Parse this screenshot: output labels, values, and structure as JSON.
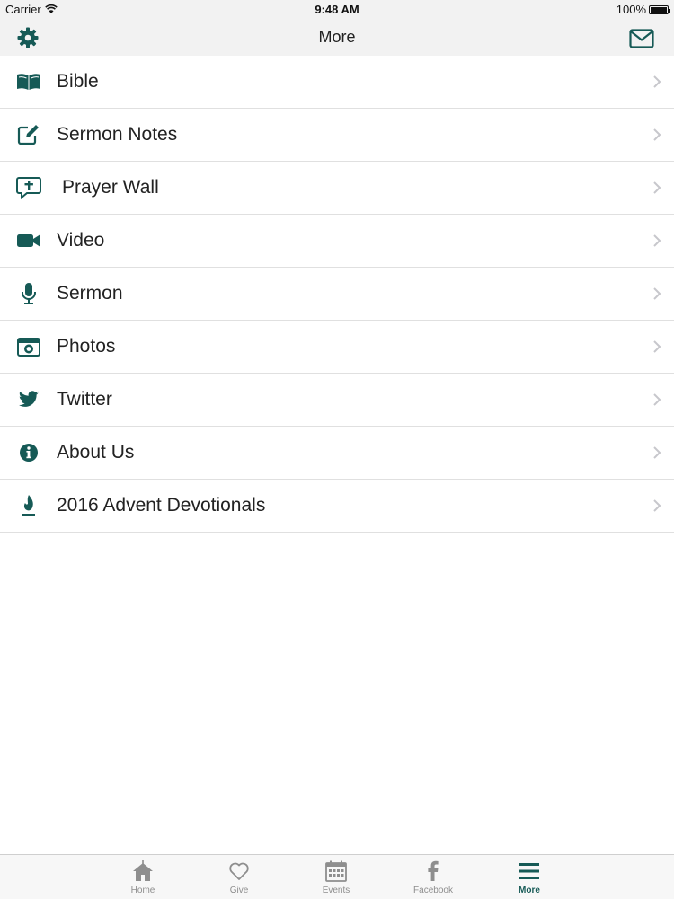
{
  "status_bar": {
    "carrier": "Carrier",
    "time": "9:48 AM",
    "battery": "100%"
  },
  "nav": {
    "title": "More",
    "left_icon": "gear-icon",
    "right_icon": "mail-icon"
  },
  "colors": {
    "accent": "#165a56",
    "chevron": "#c7c7cc",
    "tab_inactive": "#8e8e8e"
  },
  "menu": [
    {
      "label": "Bible",
      "icon": "book-icon"
    },
    {
      "label": "Sermon Notes",
      "icon": "edit-icon"
    },
    {
      "label": "Prayer Wall",
      "icon": "prayer-chat-icon"
    },
    {
      "label": "Video",
      "icon": "video-camera-icon"
    },
    {
      "label": "Sermon",
      "icon": "microphone-icon"
    },
    {
      "label": "Photos",
      "icon": "camera-icon"
    },
    {
      "label": "Twitter",
      "icon": "twitter-bird-icon"
    },
    {
      "label": "About Us",
      "icon": "info-icon"
    },
    {
      "label": "2016 Advent Devotionals",
      "icon": "candle-flame-icon"
    }
  ],
  "tabs": [
    {
      "label": "Home",
      "icon": "church-icon",
      "active": false
    },
    {
      "label": "Give",
      "icon": "heart-icon",
      "active": false
    },
    {
      "label": "Events",
      "icon": "calendar-icon",
      "active": false
    },
    {
      "label": "Facebook",
      "icon": "facebook-icon",
      "active": false
    },
    {
      "label": "More",
      "icon": "menu-icon",
      "active": true
    }
  ]
}
